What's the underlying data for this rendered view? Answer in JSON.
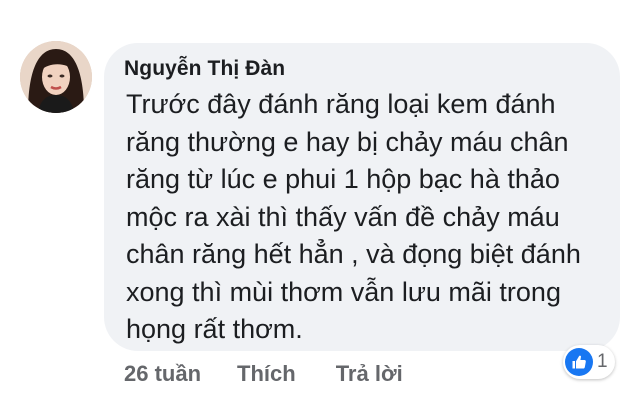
{
  "comment": {
    "author": "Nguyễn Thị Đàn",
    "text": "Trước đây đánh răng loại kem đánh\nrăng thường e hay bị chảy máu chân\nrăng từ lúc e phui 1 hộp bạc hà thảo\nmộc ra xài thì thấy vấn đề chảy máu\nchân răng hết hẳn , và đọng biệt đánh\nxong thì mùi thơm vẫn lưu mãi trong\nhọng rất thơm."
  },
  "actions": {
    "time": "26 tuần",
    "like_label": "Thích",
    "reply_label": "Trả lời"
  },
  "reactions": {
    "icon": "thumbs-up-icon",
    "count": "1"
  },
  "colors": {
    "bubble": "#f0f2f5",
    "text": "#1c1e21",
    "secondary": "#65676b",
    "like_blue": "#1877f2"
  }
}
